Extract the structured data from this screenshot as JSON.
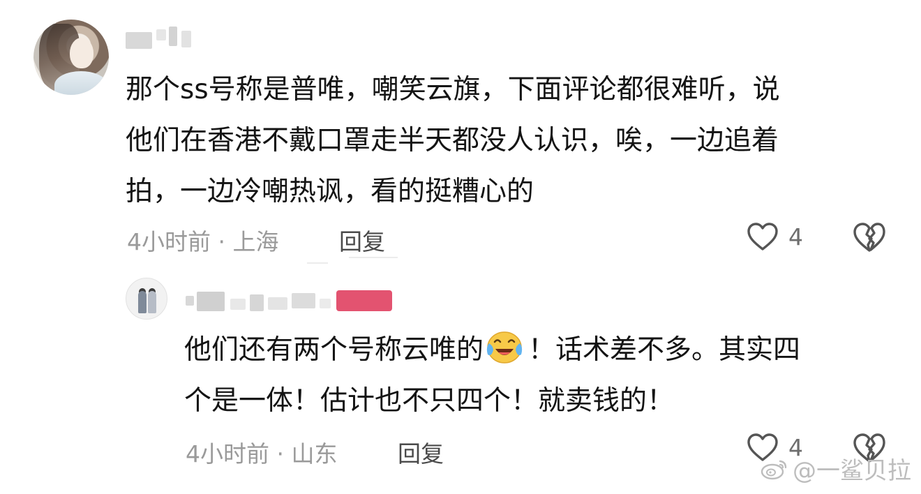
{
  "main_comment": {
    "avatar_icon": "avatar-anime-character",
    "username_visible": "",
    "text_lines": [
      "那个ss号称是普唯，嘲笑云旗，下面评论都很难听，说",
      "他们在香港不戴口罩走半天都没人认识，唉，一边追着",
      "拍，一边冷嘲热讽，看的挺糟心的"
    ],
    "meta": "4小时前 · 上海",
    "reply_label": "回复",
    "like_count": "4"
  },
  "reply_comment": {
    "avatar_icon": "avatar-two-people",
    "text_line1_before_emoji": "他们还有两个号称云唯的",
    "emoji_icon": "laughing-crying-emoji",
    "text_line1_after_emoji": "！话术差不多。其实四",
    "text_line2": "个是一体！估计也不只四个！就卖钱的！",
    "meta": "4小时前 · 山东",
    "reply_label": "回复",
    "like_count": "4"
  },
  "watermark": {
    "icon": "weibo-icon",
    "text": "@一鲨贝拉"
  },
  "colors": {
    "text": "#141414",
    "meta": "#9a9a9a",
    "reply": "#4a4a4a",
    "icon_stroke": "#555555",
    "watermark": "#bdbdbd"
  }
}
